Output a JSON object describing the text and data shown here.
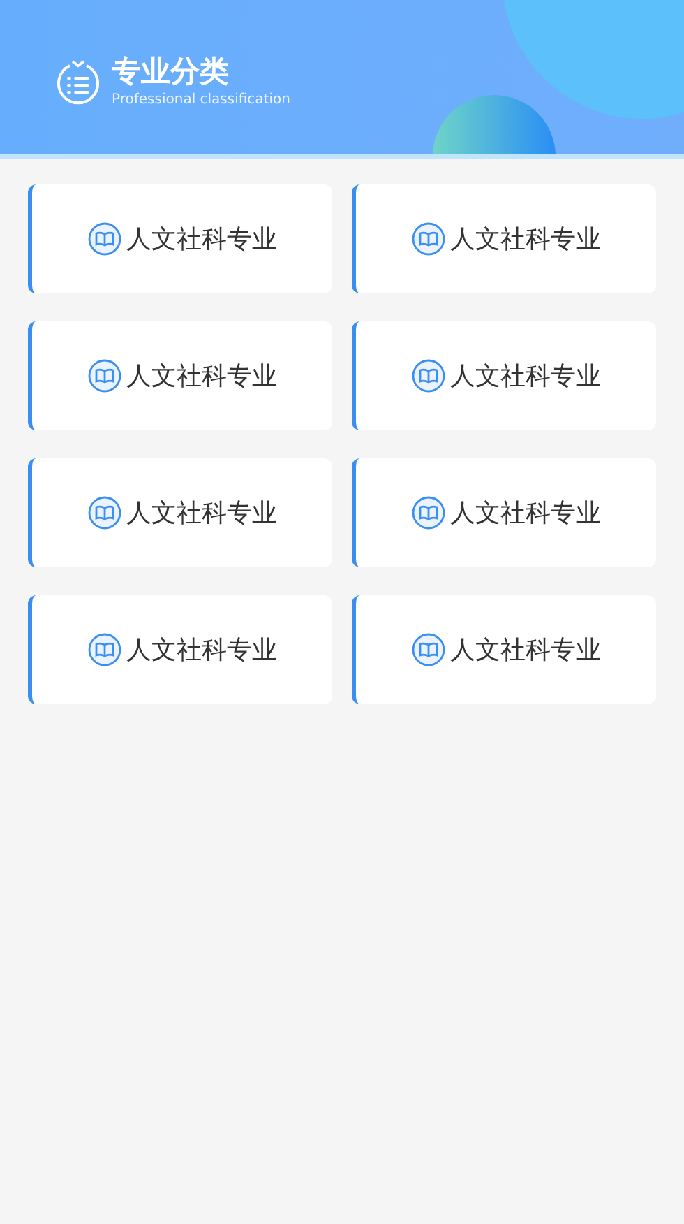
{
  "header": {
    "title": "专业分类",
    "subtitle": "Professional classification"
  },
  "categories": [
    {
      "label": "人文社科专业"
    },
    {
      "label": "人文社科专业"
    },
    {
      "label": "人文社科专业"
    },
    {
      "label": "人文社科专业"
    },
    {
      "label": "人文社科专业"
    },
    {
      "label": "人文社科专业"
    },
    {
      "label": "人文社科专业"
    },
    {
      "label": "人文社科专业"
    }
  ]
}
